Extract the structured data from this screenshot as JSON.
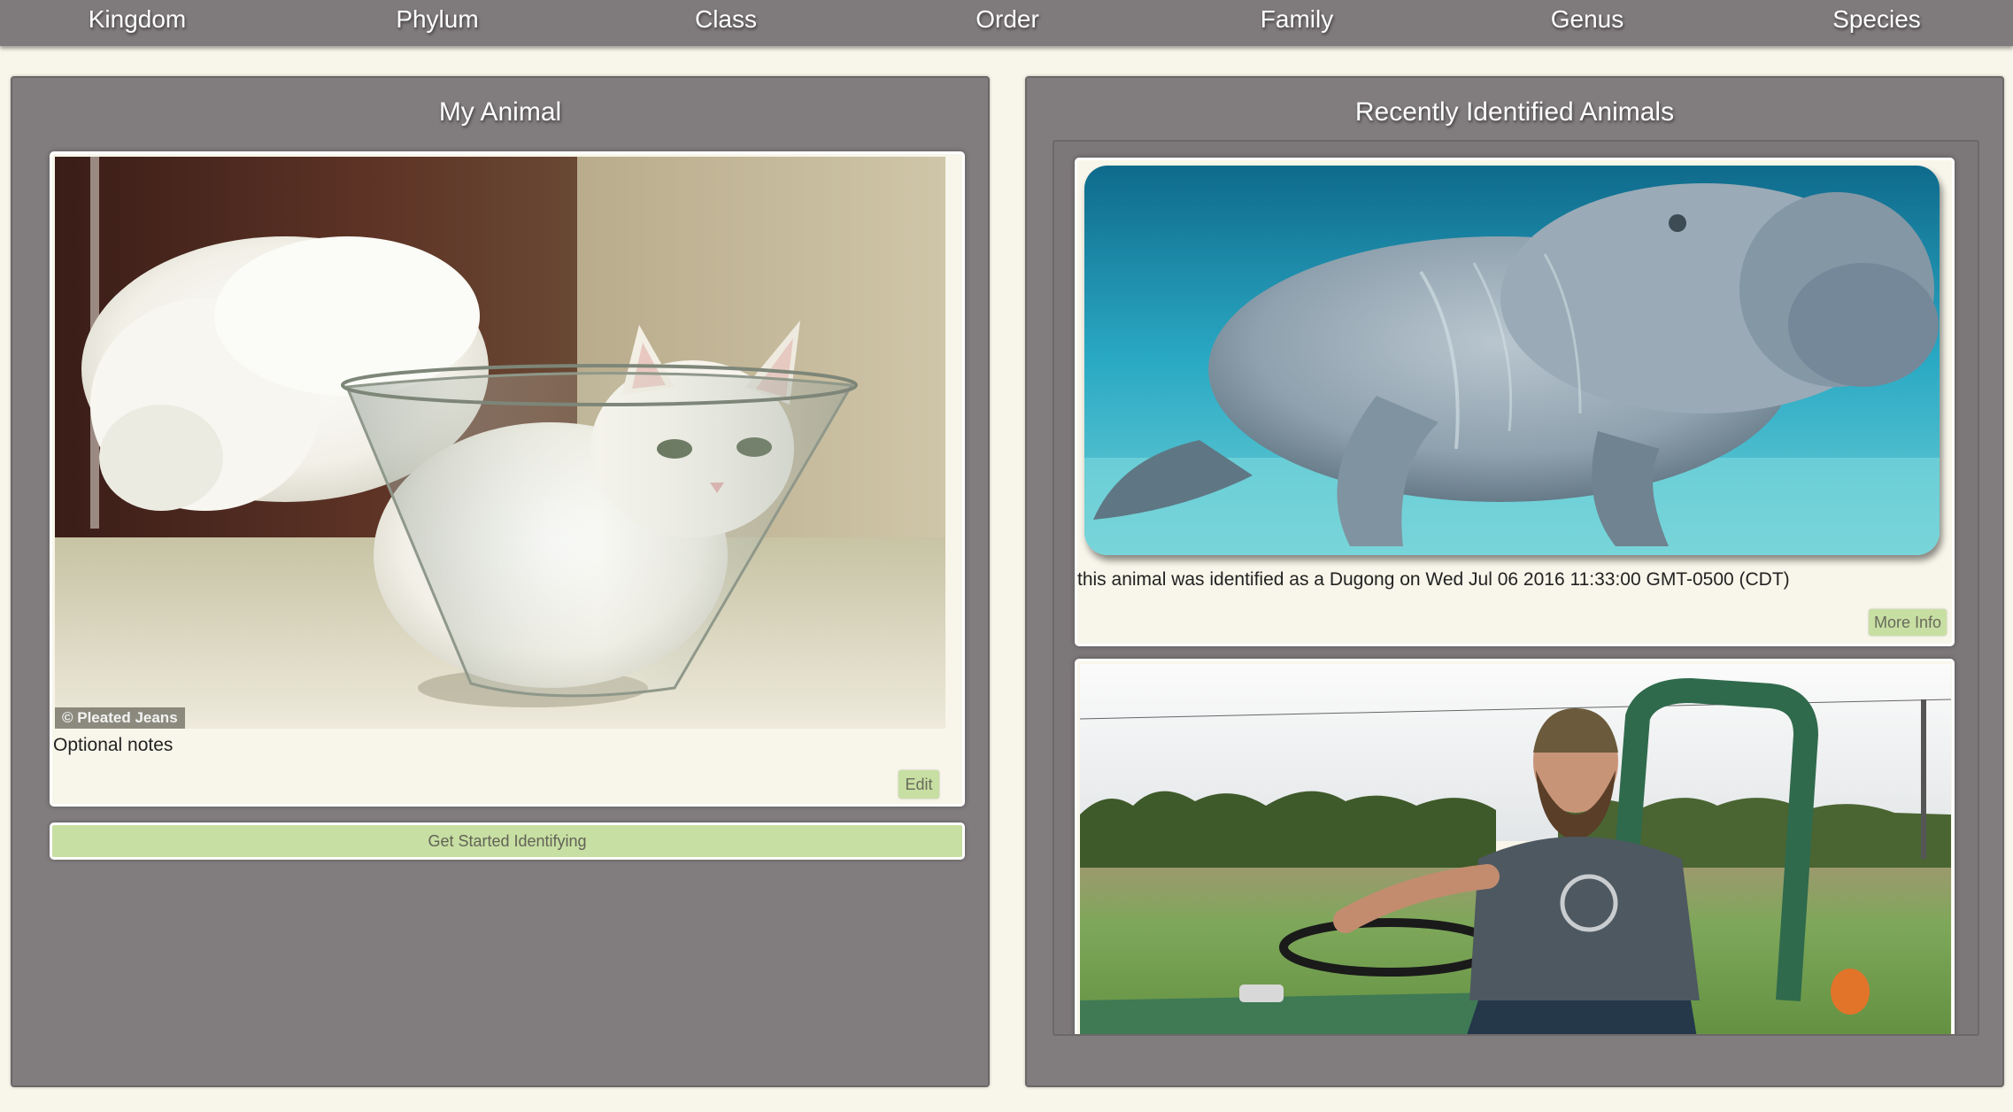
{
  "nav": {
    "items": [
      "Kingdom",
      "Phylum",
      "Class",
      "Order",
      "Family",
      "Genus",
      "Species"
    ]
  },
  "my_animal": {
    "title": "My Animal",
    "photo_credit": "© Pleated Jeans",
    "notes": "Optional notes",
    "edit_label": "Edit",
    "get_started_label": "Get Started Identifying"
  },
  "recent": {
    "title": "Recently Identified Animals",
    "items": [
      {
        "caption": "this animal was identified as a Dugong on Wed Jul 06 2016 11:33:00 GMT-0500 (CDT)",
        "more_info_label": "More Info"
      }
    ]
  },
  "colors": {
    "nav_bg": "#7f7a7b",
    "panel_bg": "#817c7d",
    "page_bg": "#f8f6ea",
    "button_green": "#c7dfa2"
  }
}
